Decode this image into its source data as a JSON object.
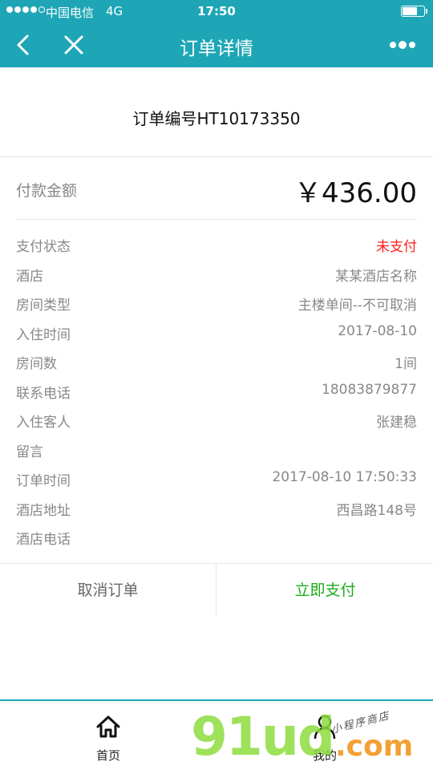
{
  "status_bar": {
    "carrier": "中国电信",
    "network": "4G",
    "time": "17:50"
  },
  "nav": {
    "title": "订单详情",
    "back_icon": "chevron-left-icon",
    "close_icon": "close-icon",
    "more_icon": "more-dots-icon"
  },
  "order": {
    "number_text": "订单编号HT10173350"
  },
  "amount": {
    "label": "付款金额",
    "value": "￥436.00"
  },
  "details": [
    {
      "label": "支付状态",
      "value": "未支付"
    },
    {
      "label": "酒店",
      "value": "某某酒店名称"
    },
    {
      "label": "房间类型",
      "value": "主楼单间--不可取消"
    },
    {
      "label": "入住时间",
      "value": "2017-08-10"
    },
    {
      "label": "房间数",
      "value": "1间"
    },
    {
      "label": "联系电话",
      "value": "18083879877"
    },
    {
      "label": "入住客人",
      "value": "张建稳"
    },
    {
      "label": "留言",
      "value": ""
    },
    {
      "label": "订单时间",
      "value": "2017-08-10 17:50:33"
    },
    {
      "label": "酒店地址",
      "value": "西昌路148号"
    },
    {
      "label": "酒店电话",
      "value": ""
    }
  ],
  "actions": {
    "cancel_label": "取消订单",
    "pay_label": "立即支付"
  },
  "tabbar": {
    "items": [
      {
        "label": "首页",
        "icon": "home-icon"
      },
      {
        "label": "我的",
        "icon": "user-icon"
      }
    ]
  },
  "watermark": {
    "main": "91ud",
    "suffix": ".com",
    "tagline": "小程序商店"
  },
  "colors": {
    "accent": "#1ea6b6",
    "unpaid": "#ff1a1a",
    "pay": "#1aad19"
  }
}
